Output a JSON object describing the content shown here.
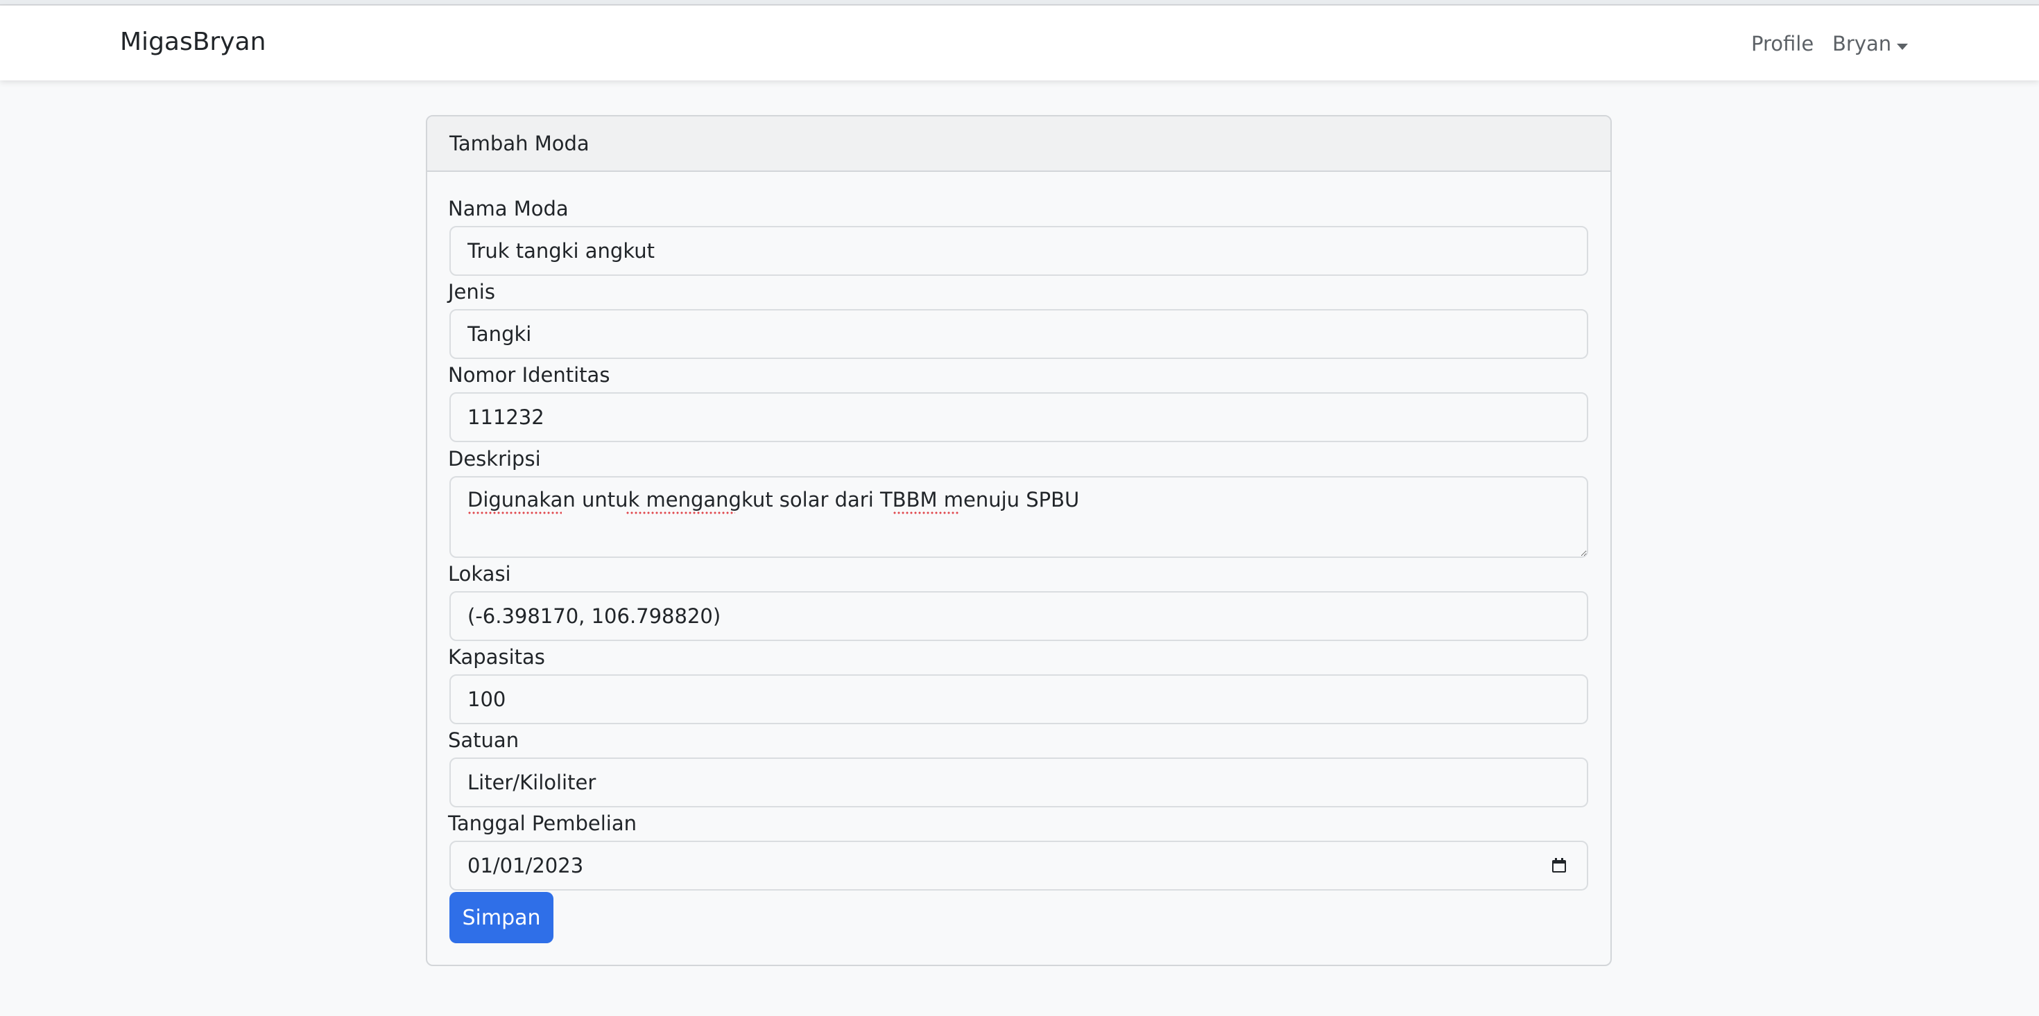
{
  "navbar": {
    "brand": "MigasBryan",
    "profile_link": "Profile",
    "user_menu": "Bryan"
  },
  "form": {
    "title": "Tambah Moda",
    "fields": {
      "nama_moda": {
        "label": "Nama Moda",
        "value": "Truk tangki angkut"
      },
      "jenis": {
        "label": "Jenis",
        "value": "Tangki"
      },
      "nomor_identitas": {
        "label": "Nomor Identitas",
        "value": "111232"
      },
      "deskripsi": {
        "label": "Deskripsi",
        "value": "Digunakan untuk mengangkut solar dari TBBM menuju SPBU"
      },
      "lokasi": {
        "label": "Lokasi",
        "value": "(-6.398170, 106.798820)"
      },
      "kapasitas": {
        "label": "Kapasitas",
        "value": "100"
      },
      "satuan": {
        "label": "Satuan",
        "value": "Liter/Kiloliter"
      },
      "tanggal_pembelian": {
        "label": "Tanggal Pembelian",
        "value": "01/01/2023"
      }
    },
    "submit_label": "Simpan"
  },
  "colors": {
    "primary": "#2f6fe8",
    "background": "#f8f9fa",
    "navbar": "#ffffff",
    "spellcheck": "#e0474c"
  },
  "icons": {
    "date_picker": "calendar-icon",
    "user_menu_toggle": "caret-down-icon"
  }
}
